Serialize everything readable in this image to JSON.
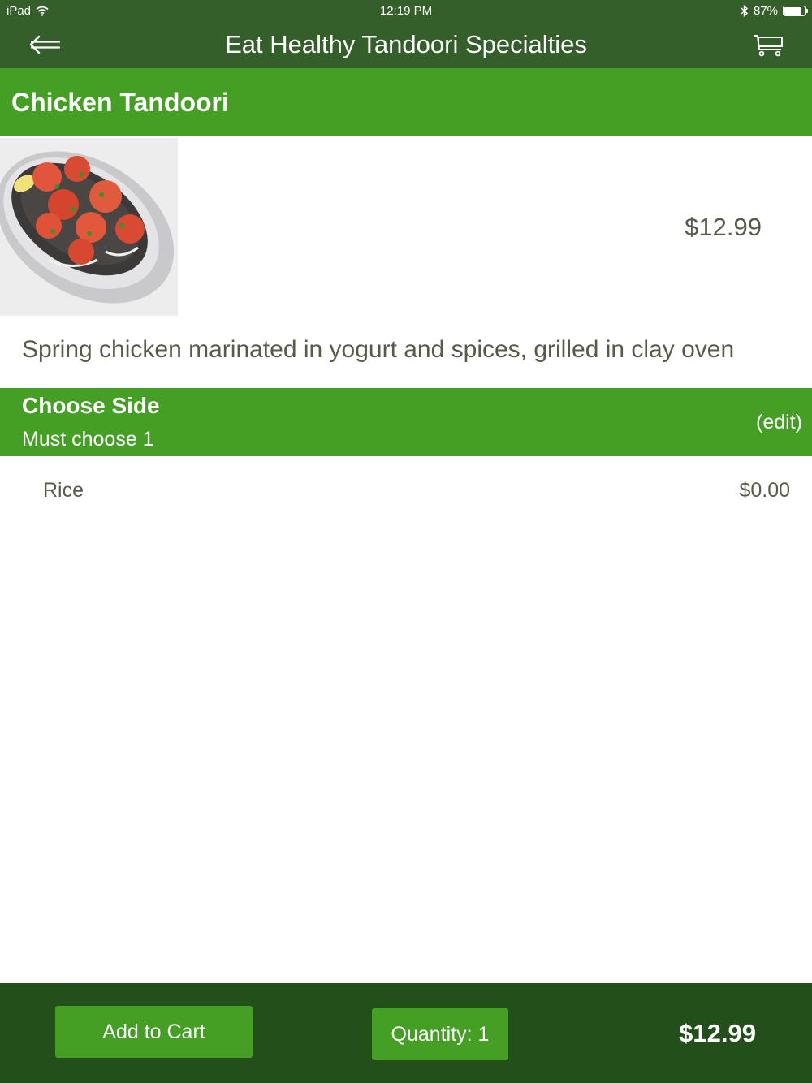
{
  "status_bar": {
    "device": "iPad",
    "time": "12:19 PM",
    "battery_percent": "87%",
    "battery_level": 0.87
  },
  "nav": {
    "title": "Eat Healthy Tandoori Specialties",
    "back_icon": "back-arrow-icon",
    "cart_icon": "cart-icon"
  },
  "item": {
    "name": "Chicken Tandoori",
    "price": "$12.99",
    "description": "Spring chicken marinated in yogurt and spices, grilled in clay oven"
  },
  "option_group": {
    "title": "Choose Side",
    "requirement": "Must choose 1",
    "edit_label": "(edit)",
    "selections": [
      {
        "name": "Rice",
        "price": "$0.00"
      }
    ]
  },
  "footer": {
    "add_to_cart_label": "Add to Cart",
    "quantity_label": "Quantity: 1",
    "total": "$12.99"
  },
  "colors": {
    "nav_bg": "#345f2a",
    "section_green": "#459f25",
    "footer_bg": "#23501a",
    "body_text": "#5a5a4a"
  }
}
